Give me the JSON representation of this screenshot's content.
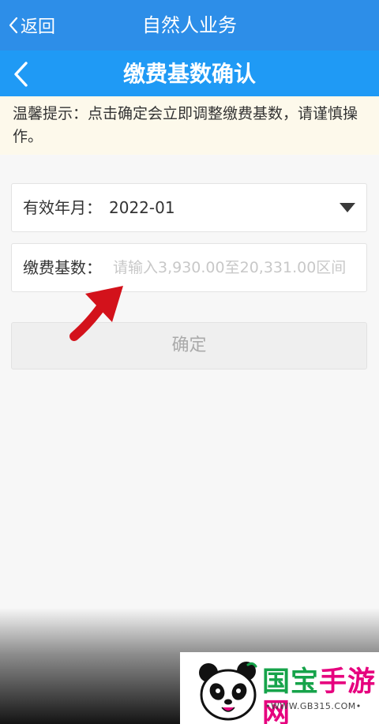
{
  "topbar": {
    "back_label": "返回",
    "title": "自然人业务"
  },
  "navbar": {
    "title": "缴费基数确认"
  },
  "tip": {
    "text": "温馨提示：点击确定会立即调整缴费基数，请谨慎操作。"
  },
  "form": {
    "effective_month": {
      "label": "有效年月：",
      "value": "2022-01"
    },
    "base": {
      "label": "缴费基数：",
      "placeholder": "请输入3,930.00至20,331.00区间"
    }
  },
  "confirm_button": {
    "label": "确定"
  },
  "watermark": {
    "brand_part1": "国宝",
    "brand_part2": "手游网",
    "url": "•WWW.GB315.COM•"
  },
  "colors": {
    "topbar": "#2d8ee8",
    "navbar": "#1f9af5",
    "tip_bg": "#fdf9eb",
    "arrow": "#d3121b",
    "brand_green": "#16a34a",
    "brand_pink": "#e6007e"
  },
  "icons": {
    "back": "chevron-left-icon",
    "dropdown": "caret-down-icon",
    "annotation": "red-arrow-icon"
  }
}
